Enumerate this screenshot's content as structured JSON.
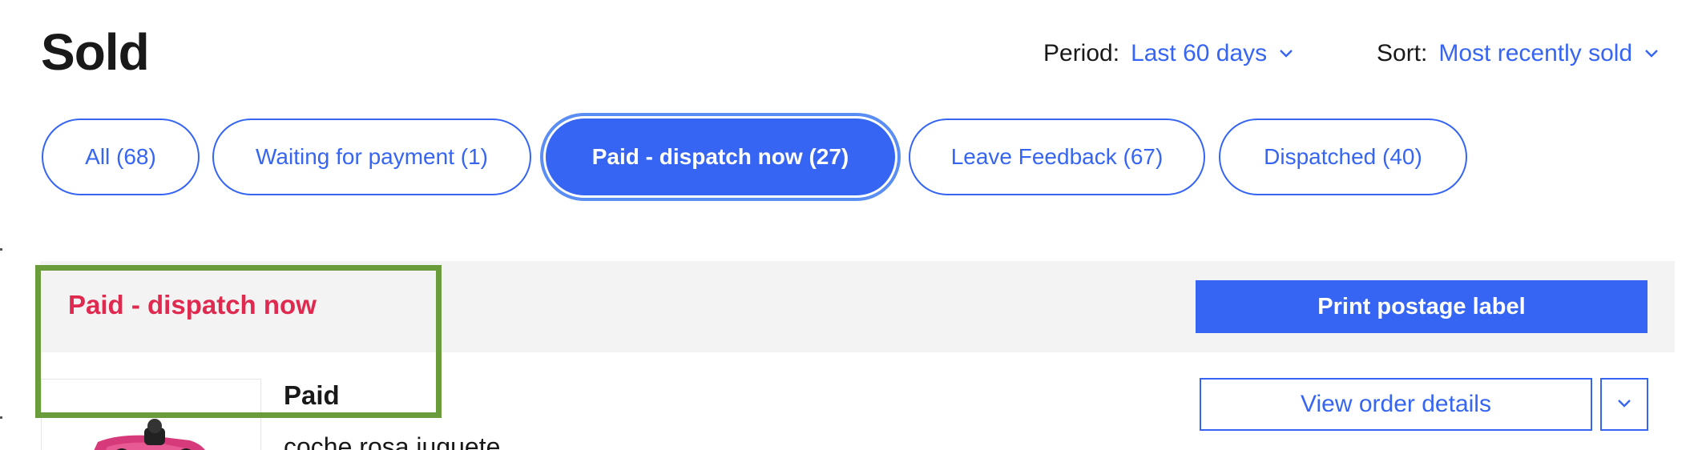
{
  "header": {
    "title": "Sold",
    "period": {
      "label": "Period:",
      "value": "Last 60 days"
    },
    "sort": {
      "label": "Sort:",
      "value": "Most recently sold"
    }
  },
  "tabs": [
    {
      "label": "All (68)",
      "active": false
    },
    {
      "label": "Waiting for payment (1)",
      "active": false
    },
    {
      "label": "Paid - dispatch now (27)",
      "active": true
    },
    {
      "label": "Leave Feedback (67)",
      "active": false
    },
    {
      "label": "Dispatched (40)",
      "active": false
    }
  ],
  "section": {
    "status": "Paid - dispatch now",
    "print_button": "Print postage label"
  },
  "order": {
    "status": "Paid",
    "item_title": "coche rosa juguete",
    "view_button": "View order details"
  },
  "colors": {
    "accent": "#3665f3",
    "alert": "#e0294e",
    "highlight_box": "#6a9c3c"
  },
  "icons": [
    "chevron-down-icon"
  ]
}
